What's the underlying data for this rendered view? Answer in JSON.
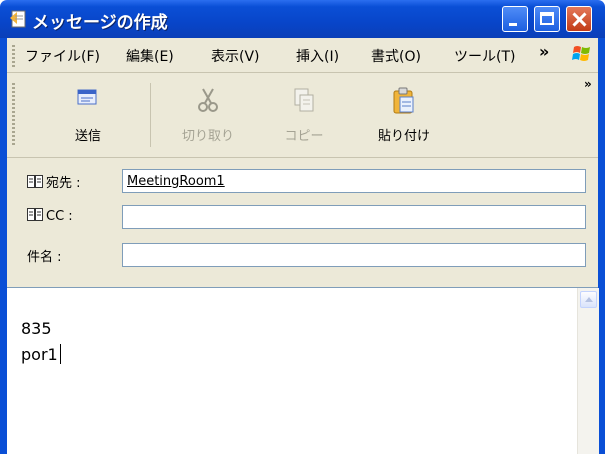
{
  "window": {
    "title": "メッセージの作成",
    "controls": [
      "minimize",
      "maximize",
      "close"
    ]
  },
  "menu": {
    "items": [
      "ファイル(F)",
      "編集(E)",
      "表示(V)",
      "挿入(I)",
      "書式(O)",
      "ツール(T)"
    ],
    "overflow": "»"
  },
  "toolbar": {
    "items": [
      {
        "label": "送信",
        "icon": "send-icon",
        "enabled": true
      },
      {
        "label": "切り取り",
        "icon": "scissors-icon",
        "enabled": false
      },
      {
        "label": "コピー",
        "icon": "copy-icon",
        "enabled": false
      },
      {
        "label": "貼り付け",
        "icon": "paste-icon",
        "enabled": true
      }
    ],
    "overflow": "»"
  },
  "header": {
    "to_label": "宛先 :",
    "to_value": "MeetingRoom1",
    "cc_label": "CC :",
    "cc_value": "",
    "subject_label": "件名 :",
    "subject_value": ""
  },
  "body": {
    "lines": [
      "835",
      "por1"
    ]
  },
  "colors": {
    "title_bar": "#0a4fd6",
    "chrome": "#ece9d8",
    "input_border": "#7f9db9",
    "close_button": "#c23b16"
  }
}
